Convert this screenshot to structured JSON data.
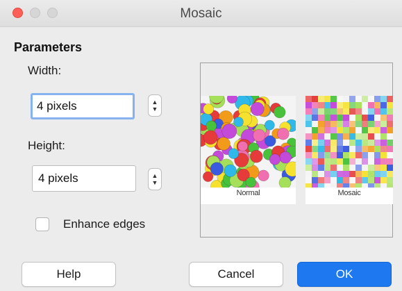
{
  "window": {
    "title": "Mosaic"
  },
  "parameters": {
    "section_title": "Parameters",
    "width_label": "Width:",
    "width_value": "4 pixels",
    "height_label": "Height:",
    "height_value": "4 pixels",
    "enhance_edges_label": "Enhance edges",
    "enhance_edges_checked": false
  },
  "preview": {
    "normal_caption": "Normal",
    "mosaic_caption": "Mosaic"
  },
  "buttons": {
    "help": "Help",
    "cancel": "Cancel",
    "ok": "OK"
  },
  "colors": {
    "accent": "#1e78f0",
    "close": "#ff5f57",
    "palette": [
      "#e63b3b",
      "#f29a1a",
      "#f5e12e",
      "#49c23b",
      "#2fb8e8",
      "#3a5be0",
      "#c44ad9",
      "#f06fb0",
      "#a6e05a",
      "#ffffff"
    ]
  }
}
